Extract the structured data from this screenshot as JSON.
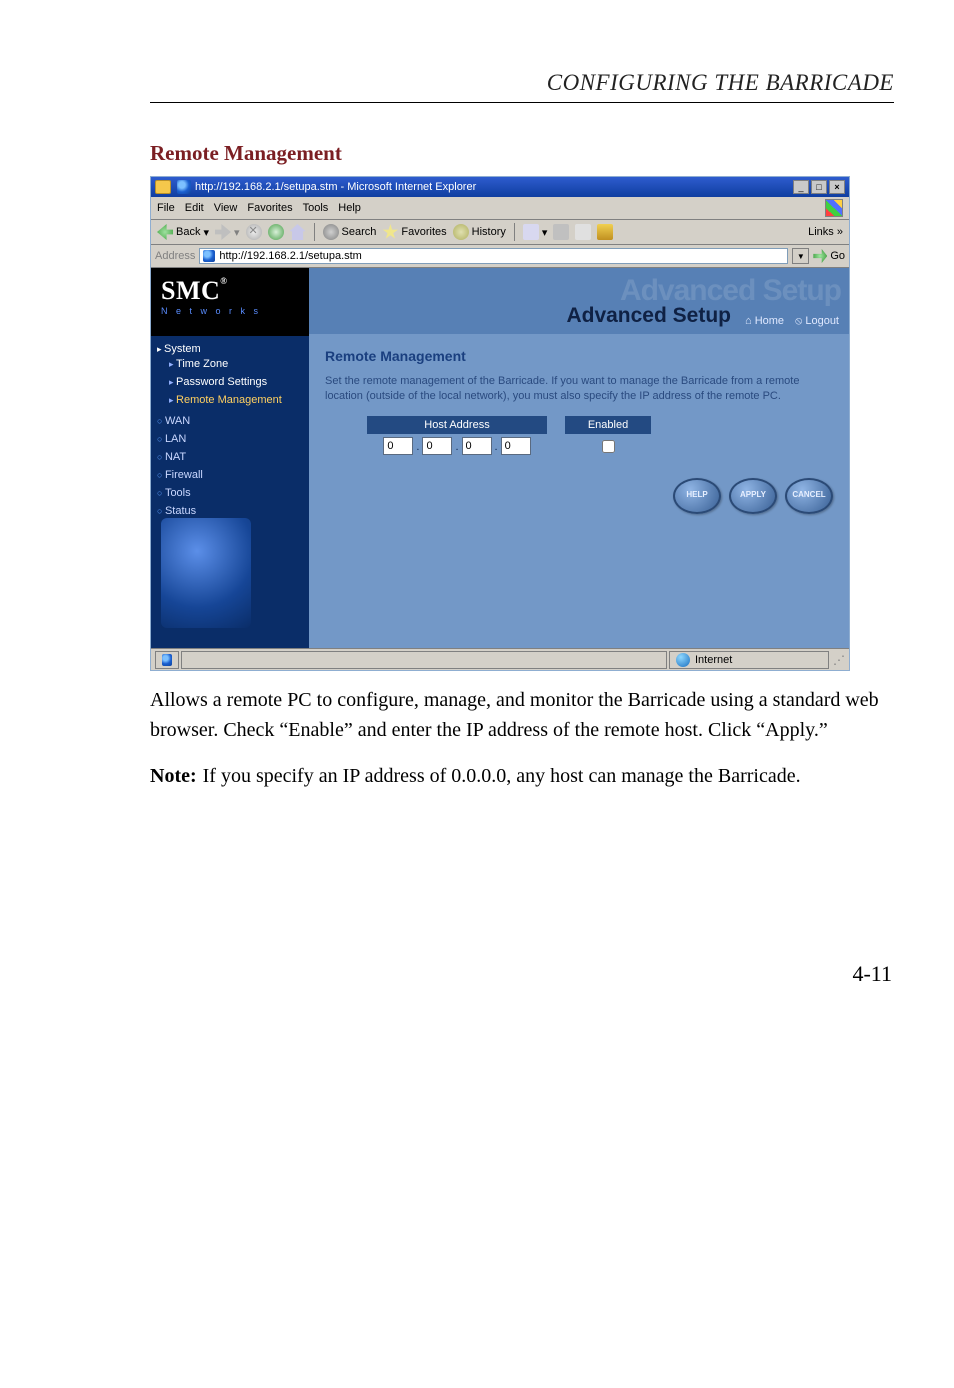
{
  "page_header": "CONFIGURING THE BARRICADE",
  "section_title": "Remote Management",
  "browser": {
    "title": "http://192.168.2.1/setupa.stm - Microsoft Internet Explorer",
    "menubar": [
      "File",
      "Edit",
      "View",
      "Favorites",
      "Tools",
      "Help"
    ],
    "back": "Back",
    "search": "Search",
    "favorites": "Favorites",
    "history": "History",
    "links_label": "Links",
    "address_label": "Address",
    "address_value": "http://192.168.2.1/setupa.stm",
    "go_label": "Go"
  },
  "logo": {
    "brand": "SMC",
    "reg": "®",
    "net": "N e t w o r k s"
  },
  "banner": {
    "ghost": "Advanced Setup",
    "main": "Advanced Setup",
    "home": "Home",
    "logout": "Logout"
  },
  "sidebar": {
    "system": "System",
    "system_children": [
      "Time Zone",
      "Password Settings",
      "Remote Management"
    ],
    "items": [
      "WAN",
      "LAN",
      "NAT",
      "Firewall",
      "Tools",
      "Status"
    ]
  },
  "panel": {
    "heading": "Remote Management",
    "desc": "Set the remote management of the Barricade. If you want to manage the Barricade from a remote location (outside of the local network), you must also specify the IP address of the remote PC.",
    "host_label": "Host Address",
    "enabled_label": "Enabled",
    "ip": [
      "0",
      "0",
      "0",
      "0"
    ],
    "buttons": {
      "help": "HELP",
      "apply": "APPLY",
      "cancel": "CANCEL"
    }
  },
  "statusbar": {
    "zone": "Internet"
  },
  "copy": {
    "para": "Allows a remote PC to configure, manage, and monitor the Barricade using a standard web browser. Check “Enable” and enter the IP address of the remote host. Click “Apply.”",
    "note_label": "Note:",
    "note_body": "If you specify an IP address of 0.0.0.0, any host can manage the Barricade."
  },
  "page_number": "4-11"
}
